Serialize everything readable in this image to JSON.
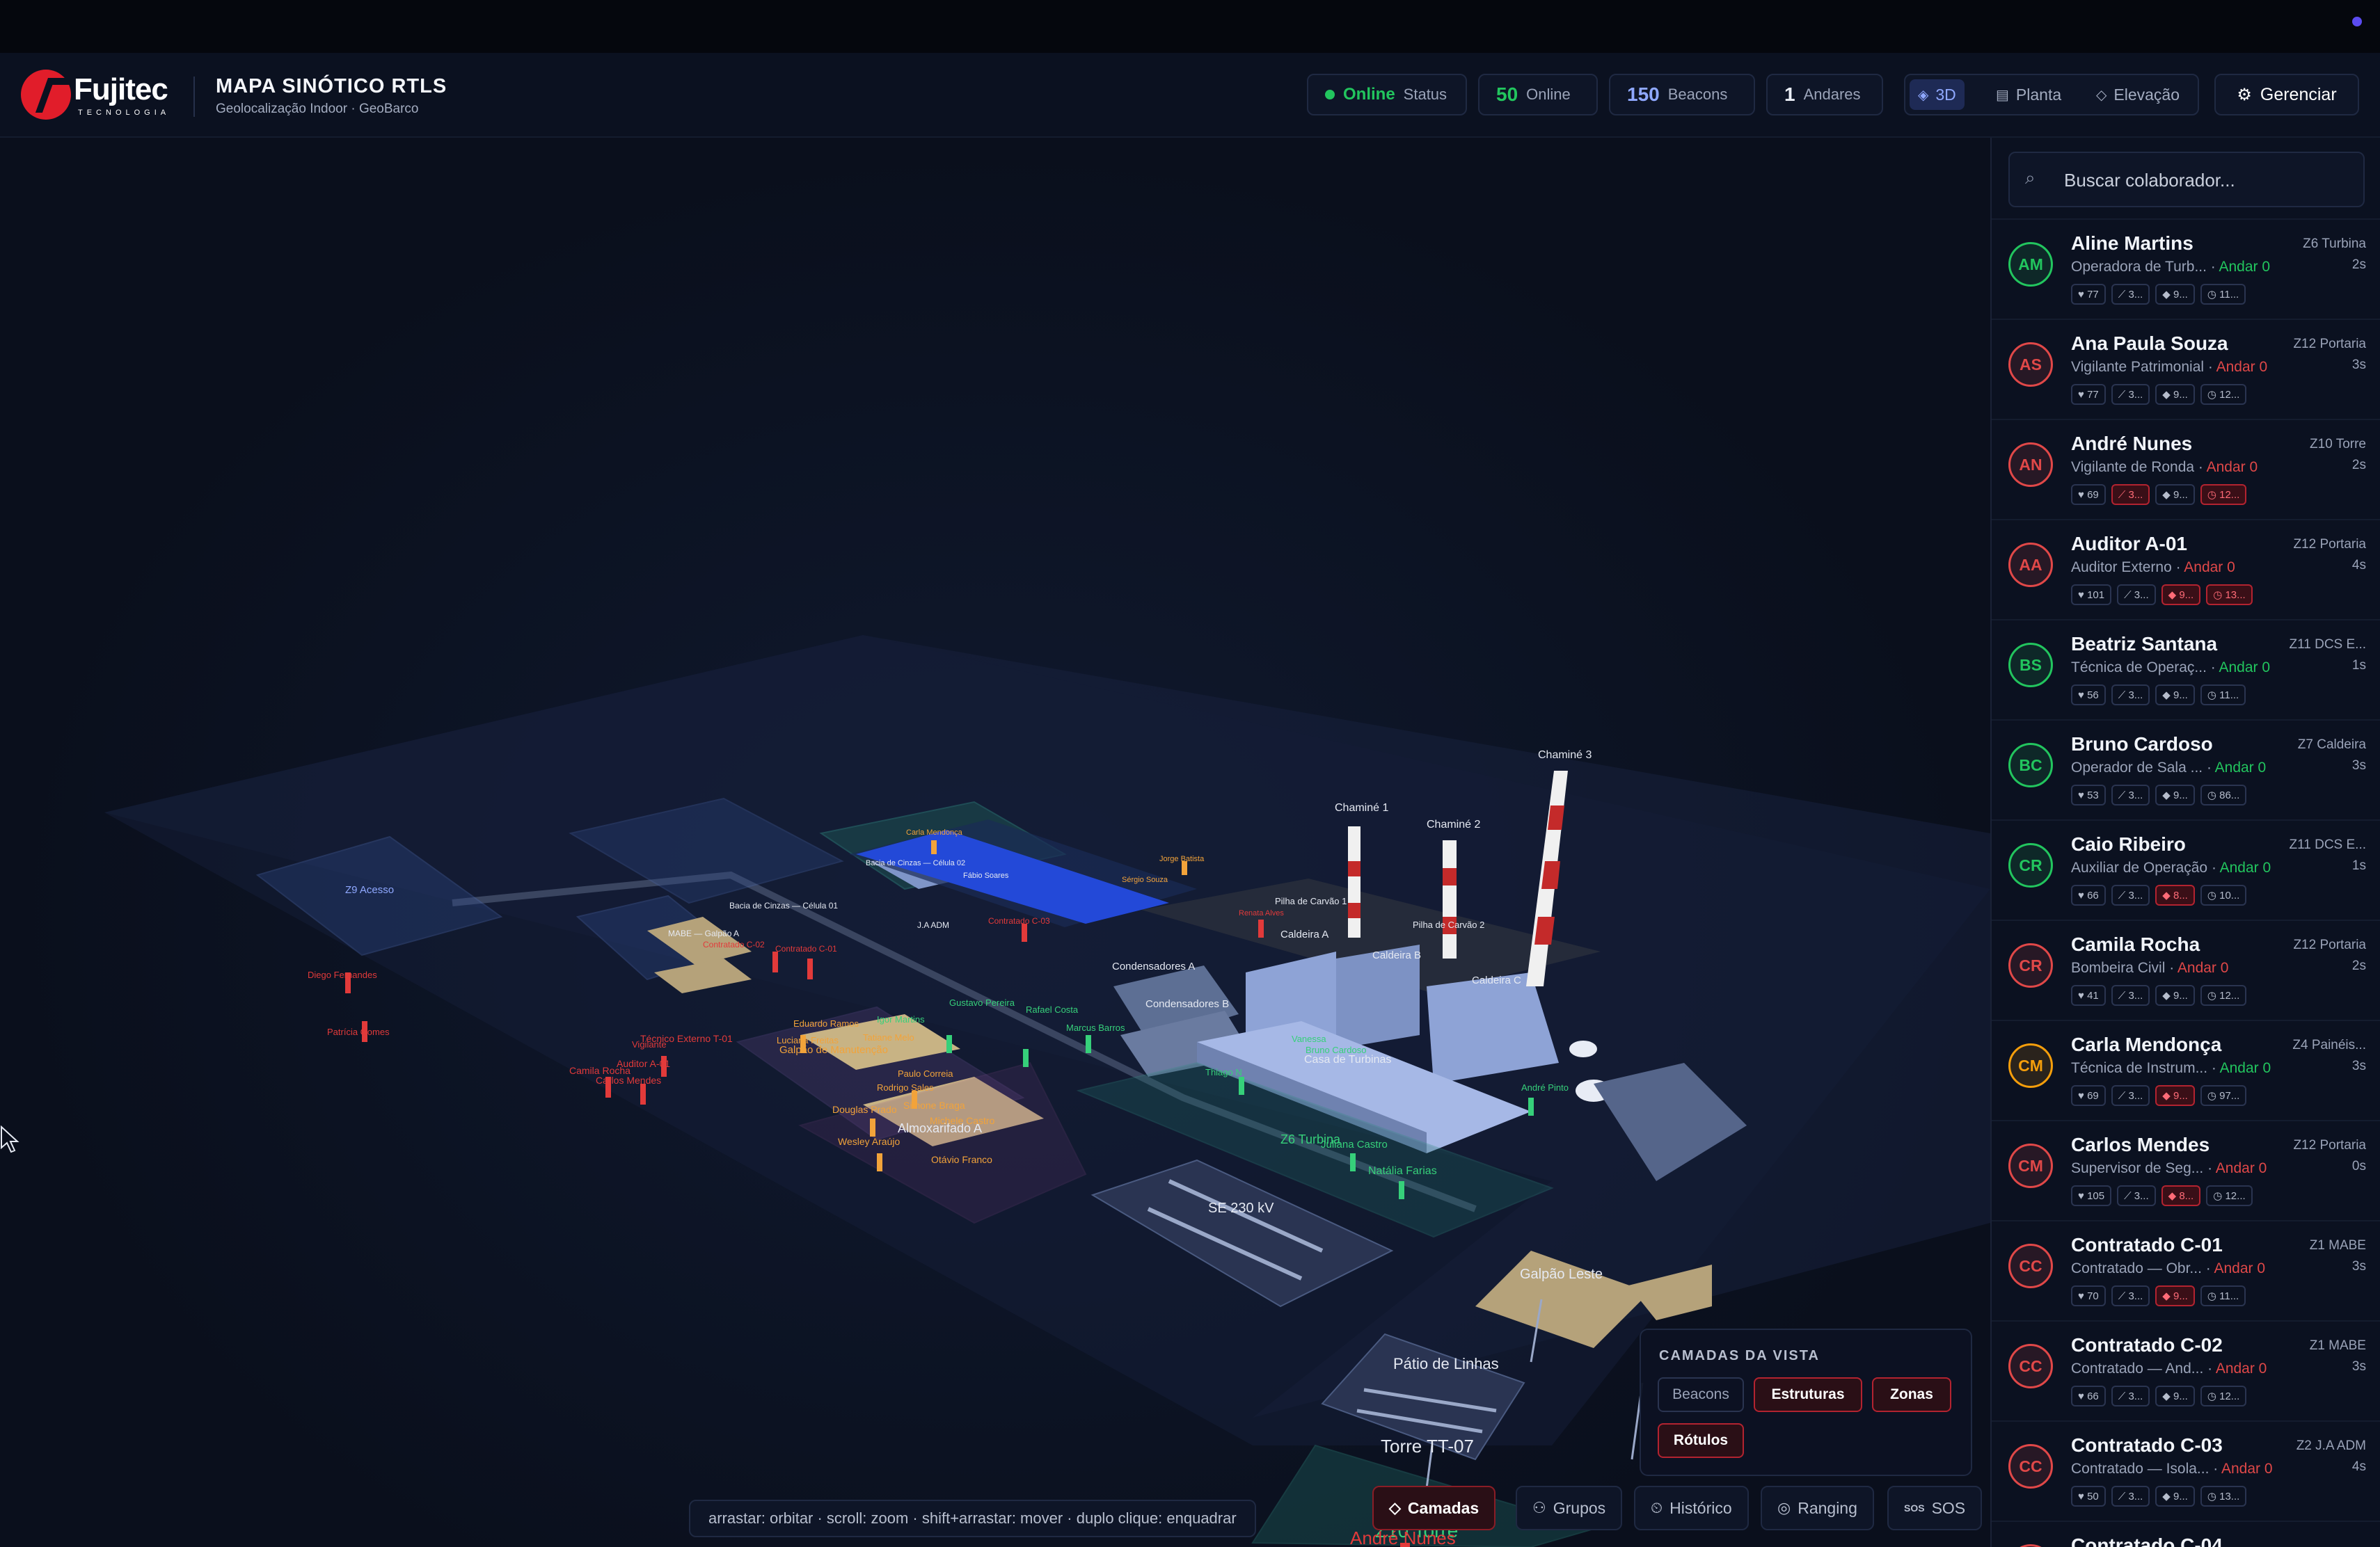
{
  "app": {
    "brand": "Fujitec",
    "brand_sub": "TECNOLOGIA",
    "title": "MAPA SINÓTICO RTLS",
    "subtitle": "Geolocalização Indoor · GeoBarco"
  },
  "stats": {
    "status_value": "Online",
    "status_label": "Status",
    "online_value": "50",
    "online_label": "Online",
    "beacons_value": "150",
    "beacons_label": "Beacons",
    "floors_value": "1",
    "floors_label": "Andares"
  },
  "view_modes": {
    "mode_3d": "3D",
    "plan": "Planta",
    "elevation": "Elevação"
  },
  "manage_label": "Gerenciar",
  "search": {
    "placeholder": "Buscar colaborador..."
  },
  "colors": {
    "accent_red": "#e11d2a",
    "online_green": "#22c55e",
    "alert_red": "#e04848",
    "view_blue": "#8fa8ff"
  },
  "people": [
    {
      "initials": "AM",
      "name": "Aline Martins",
      "role": "Operadora de Turb...",
      "floor": "Andar 0",
      "floor_status": "ok",
      "zone": "Z6 Turbina",
      "time": "2s",
      "hr": "77",
      "t2": "3...",
      "t3": "9...",
      "t4": "11...",
      "alerts": [],
      "color": "#22c55e"
    },
    {
      "initials": "AS",
      "name": "Ana Paula Souza",
      "role": "Vigilante Patrimonial",
      "floor": "Andar 0",
      "floor_status": "alert",
      "zone": "Z12 Portaria",
      "time": "3s",
      "hr": "77",
      "t2": "3...",
      "t3": "9...",
      "t4": "12...",
      "alerts": [],
      "color": "#e04848"
    },
    {
      "initials": "AN",
      "name": "André Nunes",
      "role": "Vigilante de Ronda",
      "floor": "Andar 0",
      "floor_status": "alert",
      "zone": "Z10 Torre",
      "time": "2s",
      "hr": "69",
      "t2": "3...",
      "t3": "9...",
      "t4": "12...",
      "alerts": [
        2,
        4
      ],
      "color": "#e04848"
    },
    {
      "initials": "AA",
      "name": "Auditor A-01",
      "role": "Auditor Externo",
      "floor": "Andar 0",
      "floor_status": "alert",
      "zone": "Z12 Portaria",
      "time": "4s",
      "hr": "101",
      "t2": "3...",
      "t3": "9...",
      "t4": "13...",
      "alerts": [
        3,
        4
      ],
      "color": "#e04848"
    },
    {
      "initials": "BS",
      "name": "Beatriz Santana",
      "role": "Técnica de Operaç...",
      "floor": "Andar 0",
      "floor_status": "ok",
      "zone": "Z11 DCS E...",
      "time": "1s",
      "hr": "56",
      "t2": "3...",
      "t3": "9...",
      "t4": "11...",
      "alerts": [],
      "color": "#22c55e"
    },
    {
      "initials": "BC",
      "name": "Bruno Cardoso",
      "role": "Operador de Sala ...",
      "floor": "Andar 0",
      "floor_status": "ok",
      "zone": "Z7 Caldeira",
      "time": "3s",
      "hr": "53",
      "t2": "3...",
      "t3": "9...",
      "t4": "86...",
      "alerts": [],
      "color": "#22c55e"
    },
    {
      "initials": "CR",
      "name": "Caio Ribeiro",
      "role": "Auxiliar de Operação",
      "floor": "Andar 0",
      "floor_status": "ok",
      "zone": "Z11 DCS E...",
      "time": "1s",
      "hr": "66",
      "t2": "3...",
      "t3": "8...",
      "t4": "10...",
      "alerts": [
        3
      ],
      "color": "#22c55e"
    },
    {
      "initials": "CR",
      "name": "Camila Rocha",
      "role": "Bombeira Civil",
      "floor": "Andar 0",
      "floor_status": "alert",
      "zone": "Z12 Portaria",
      "time": "2s",
      "hr": "41",
      "t2": "3...",
      "t3": "9...",
      "t4": "12...",
      "alerts": [],
      "color": "#e04848"
    },
    {
      "initials": "CM",
      "name": "Carla Mendonça",
      "role": "Técnica de Instrum...",
      "floor": "Andar 0",
      "floor_status": "ok",
      "zone": "Z4 Painéis...",
      "time": "3s",
      "hr": "69",
      "t2": "3...",
      "t3": "9...",
      "t4": "97...",
      "alerts": [
        3
      ],
      "color": "#f59e0b"
    },
    {
      "initials": "CM",
      "name": "Carlos Mendes",
      "role": "Supervisor de Seg...",
      "floor": "Andar 0",
      "floor_status": "alert",
      "zone": "Z12 Portaria",
      "time": "0s",
      "hr": "105",
      "t2": "3...",
      "t3": "8...",
      "t4": "12...",
      "alerts": [
        3
      ],
      "color": "#e04848"
    },
    {
      "initials": "CC",
      "name": "Contratado C-01",
      "role": "Contratado — Obr...",
      "floor": "Andar 0",
      "floor_status": "alert",
      "zone": "Z1 MABE",
      "time": "3s",
      "hr": "70",
      "t2": "3...",
      "t3": "9...",
      "t4": "11...",
      "alerts": [
        3
      ],
      "color": "#e04848"
    },
    {
      "initials": "CC",
      "name": "Contratado C-02",
      "role": "Contratado — And...",
      "floor": "Andar 0",
      "floor_status": "alert",
      "zone": "Z1 MABE",
      "time": "3s",
      "hr": "66",
      "t2": "3...",
      "t3": "9...",
      "t4": "12...",
      "alerts": [],
      "color": "#e04848"
    },
    {
      "initials": "CC",
      "name": "Contratado C-03",
      "role": "Contratado — Isola...",
      "floor": "Andar 0",
      "floor_status": "alert",
      "zone": "Z2 J.A ADM",
      "time": "4s",
      "hr": "50",
      "t2": "3...",
      "t3": "9...",
      "t4": "13...",
      "alerts": [],
      "color": "#e04848"
    },
    {
      "initials": "CC",
      "name": "Contratado C-04",
      "role": "",
      "floor": "",
      "floor_status": "alert",
      "zone": "",
      "time": "",
      "hr": "",
      "t2": "",
      "t3": "",
      "t4": "",
      "alerts": [],
      "color": "#e04848"
    }
  ],
  "map": {
    "hint": "arrastar: orbitar · scroll: zoom · shift+arrastar: mover · duplo clique: enquadrar",
    "structures": {
      "chimney1": "Chaminé 1",
      "chimney2": "Chaminé 2",
      "chimney3": "Chaminé 3",
      "boiler_a": "Caldeira A",
      "boiler_b": "Caldeira B",
      "boiler_c": "Caldeira C",
      "condensers_a": "Condensadores A",
      "condensers_b": "Condensadores B",
      "turbine_house": "Casa de Turbinas",
      "substation": "SE 230 kV",
      "east_shed": "Galpão Leste",
      "line_yard": "Pátio de Linhas",
      "tower": "Torre TT-07",
      "z10": "Z10 Torre",
      "z6": "Z6 Turbina",
      "z9": "Z9 Acesso",
      "warehouse": "Almoxarifado A",
      "coal_pile_1": "Pilha de Carvão 1",
      "coal_pile_2": "Pilha de Carvão 2",
      "ash_basin": "Bacia de Cinzas — Célula 01",
      "ash_basin_2": "Bacia de Cinzas — Célula 02",
      "mabe_shed": "MABE — Galpão A",
      "ja_adm": "J.A ADM",
      "maintenance_shed": "Galpão de Manutenção",
      "contractor_c03": "Contratado C-03",
      "contractor_c01": "Contratado C-01",
      "contractor_c02": "Contratado C-02",
      "external_tech": "Técnico Externo T-01",
      "auditor": "Auditor A-01"
    },
    "workers": {
      "diego": "Diego Fernandes",
      "patricia": "Patrícia Gomes",
      "camila": "Camila Rocha",
      "carlos": "Carlos Mendes",
      "vigilante": "Vigilante",
      "eduardo": "Eduardo Ramos",
      "luciana": "Luciana Freitas",
      "flavia": "Flávia Dias",
      "igor": "Igor Martins",
      "tatiane": "Tatiane Melo",
      "gustavo": "Gustavo Pereira",
      "rafael": "Rafael Costa",
      "marcus": "Marcus Barros",
      "paulo": "Paulo Correia",
      "rodrigo": "Rodrigo Sales",
      "simone": "Simone Braga",
      "michele": "Michele Castro",
      "douglas": "Douglas Prado",
      "wesley": "Wesley Araújo",
      "otavio": "Otávio Franco",
      "thiago": "Thiago N",
      "vanessa": "Vanessa",
      "bruno": "Bruno Cardoso",
      "juliana": "Juliana Castro",
      "natalia": "Natália Farias",
      "andre": "André Nunes",
      "andre_pinto": "André Pinto",
      "carla": "Carla Mendonça",
      "jorge": "Jorge Batista",
      "sergio": "Sérgio Souza",
      "fabio": "Fábio Soares",
      "renata": "Renata Alves"
    }
  },
  "bottom_toolbar": {
    "layers": "Camadas",
    "groups": "Grupos",
    "history": "Histórico",
    "ranging": "Ranging",
    "sos": "SOS"
  },
  "layers_panel": {
    "title": "CAMADAS DA VISTA",
    "beacons": "Beacons",
    "structures": "Estruturas",
    "zones": "Zonas",
    "labels": "Rótulos"
  }
}
